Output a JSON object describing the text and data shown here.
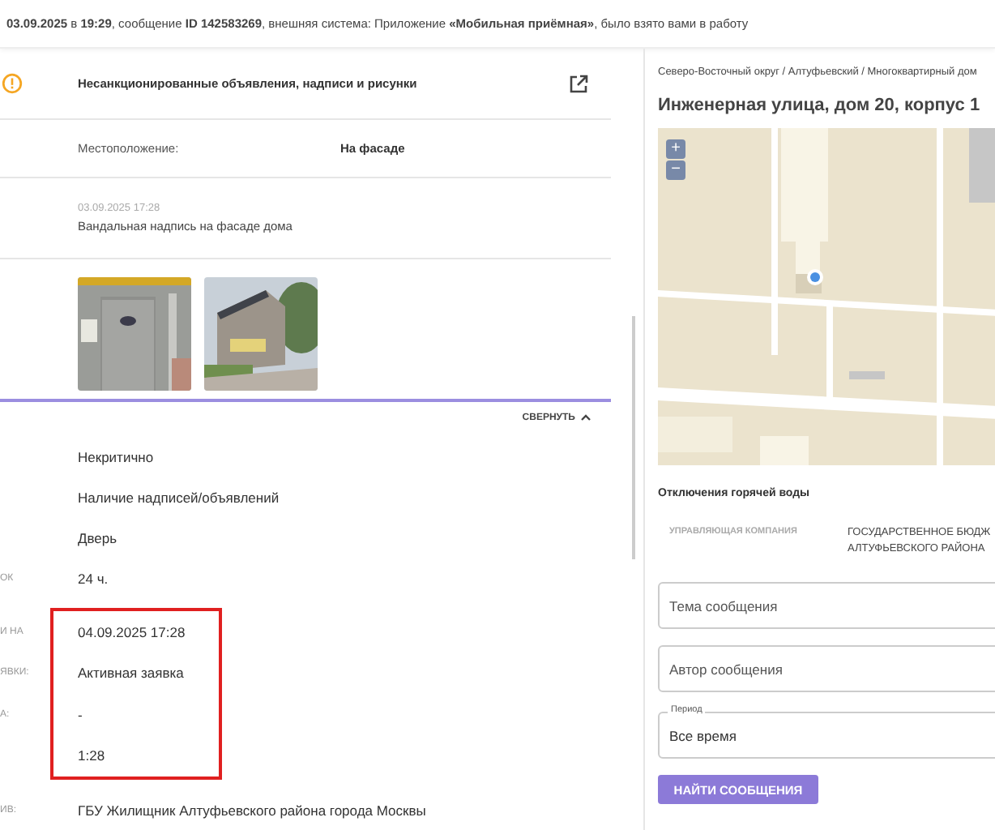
{
  "header": {
    "text": "**03.09.2025** в **19:29**, сообщение **ID 142583269**, внешняя система: Приложение **«Мобильная приёмная»**, было взято вами в работу"
  },
  "issue": {
    "title": "Несанкционированные объявления, надписи и рисунки",
    "location_label": "Местоположение:",
    "location_value": "На фасаде",
    "date": "03.09.2025 17:28",
    "description": "Вандальная надпись на фасаде дома"
  },
  "collapse_button": "СВЕРНУТЬ",
  "details": [
    {
      "value": "Некритично",
      "highlighted": false
    },
    {
      "value": "Наличие надписей/объявлений",
      "highlighted": false
    },
    {
      "value": "Дверь",
      "highlighted": false
    },
    {
      "label": "ОК",
      "value": "24 ч.",
      "highlighted": false
    },
    {
      "label": "И НА",
      "value": "04.09.2025 17:28",
      "highlighted": true
    },
    {
      "label": "ЯВКИ:",
      "value": "Активная заявка",
      "highlighted": true
    },
    {
      "label": "А:",
      "value": "-",
      "highlighted": true
    },
    {
      "value": "1:28",
      "highlighted": true
    },
    {
      "label": "ИВ:",
      "value": "ГБУ Жилищник Алтуфьевского района города Москвы",
      "highlighted": false
    }
  ],
  "right": {
    "breadcrumb": "Северо-Восточный округ / Алтуфьевский / Многоквартирный дом",
    "address": "Инженерная улица, дом 20, корпус 1",
    "zoom_in": "+",
    "zoom_out": "−",
    "outage_title": "Отключения горячей воды",
    "company_label": "УПРАВЛЯЮЩАЯ КОМПАНИЯ",
    "company_value": [
      "ГОСУДАРСТВЕННОЕ БЮДЖ",
      "АЛТУФЬЕВСКОГО РАЙОНА"
    ],
    "fields": [
      {
        "kind": "text",
        "placeholder": "Тема сообщения"
      },
      {
        "kind": "text",
        "placeholder": "Автор сообщения"
      },
      {
        "kind": "select",
        "label": "Период",
        "value": "Все время"
      }
    ],
    "search_button": "НАЙТИ СООБЩЕНИЯ"
  }
}
